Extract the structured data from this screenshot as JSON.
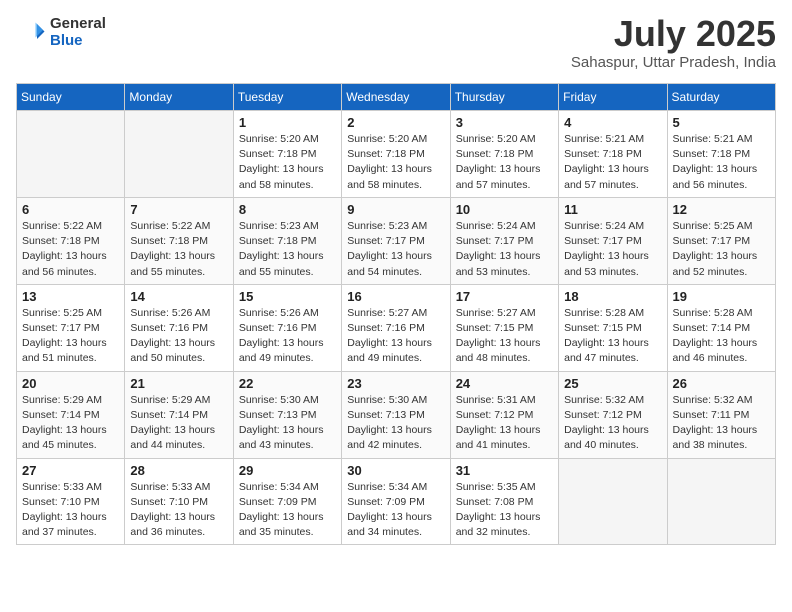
{
  "logo": {
    "general": "General",
    "blue": "Blue"
  },
  "header": {
    "title": "July 2025",
    "location": "Sahaspur, Uttar Pradesh, India"
  },
  "days_of_week": [
    "Sunday",
    "Monday",
    "Tuesday",
    "Wednesday",
    "Thursday",
    "Friday",
    "Saturday"
  ],
  "weeks": [
    [
      {
        "day": "",
        "info": ""
      },
      {
        "day": "",
        "info": ""
      },
      {
        "day": "1",
        "info": "Sunrise: 5:20 AM\nSunset: 7:18 PM\nDaylight: 13 hours\nand 58 minutes."
      },
      {
        "day": "2",
        "info": "Sunrise: 5:20 AM\nSunset: 7:18 PM\nDaylight: 13 hours\nand 58 minutes."
      },
      {
        "day": "3",
        "info": "Sunrise: 5:20 AM\nSunset: 7:18 PM\nDaylight: 13 hours\nand 57 minutes."
      },
      {
        "day": "4",
        "info": "Sunrise: 5:21 AM\nSunset: 7:18 PM\nDaylight: 13 hours\nand 57 minutes."
      },
      {
        "day": "5",
        "info": "Sunrise: 5:21 AM\nSunset: 7:18 PM\nDaylight: 13 hours\nand 56 minutes."
      }
    ],
    [
      {
        "day": "6",
        "info": "Sunrise: 5:22 AM\nSunset: 7:18 PM\nDaylight: 13 hours\nand 56 minutes."
      },
      {
        "day": "7",
        "info": "Sunrise: 5:22 AM\nSunset: 7:18 PM\nDaylight: 13 hours\nand 55 minutes."
      },
      {
        "day": "8",
        "info": "Sunrise: 5:23 AM\nSunset: 7:18 PM\nDaylight: 13 hours\nand 55 minutes."
      },
      {
        "day": "9",
        "info": "Sunrise: 5:23 AM\nSunset: 7:17 PM\nDaylight: 13 hours\nand 54 minutes."
      },
      {
        "day": "10",
        "info": "Sunrise: 5:24 AM\nSunset: 7:17 PM\nDaylight: 13 hours\nand 53 minutes."
      },
      {
        "day": "11",
        "info": "Sunrise: 5:24 AM\nSunset: 7:17 PM\nDaylight: 13 hours\nand 53 minutes."
      },
      {
        "day": "12",
        "info": "Sunrise: 5:25 AM\nSunset: 7:17 PM\nDaylight: 13 hours\nand 52 minutes."
      }
    ],
    [
      {
        "day": "13",
        "info": "Sunrise: 5:25 AM\nSunset: 7:17 PM\nDaylight: 13 hours\nand 51 minutes."
      },
      {
        "day": "14",
        "info": "Sunrise: 5:26 AM\nSunset: 7:16 PM\nDaylight: 13 hours\nand 50 minutes."
      },
      {
        "day": "15",
        "info": "Sunrise: 5:26 AM\nSunset: 7:16 PM\nDaylight: 13 hours\nand 49 minutes."
      },
      {
        "day": "16",
        "info": "Sunrise: 5:27 AM\nSunset: 7:16 PM\nDaylight: 13 hours\nand 49 minutes."
      },
      {
        "day": "17",
        "info": "Sunrise: 5:27 AM\nSunset: 7:15 PM\nDaylight: 13 hours\nand 48 minutes."
      },
      {
        "day": "18",
        "info": "Sunrise: 5:28 AM\nSunset: 7:15 PM\nDaylight: 13 hours\nand 47 minutes."
      },
      {
        "day": "19",
        "info": "Sunrise: 5:28 AM\nSunset: 7:14 PM\nDaylight: 13 hours\nand 46 minutes."
      }
    ],
    [
      {
        "day": "20",
        "info": "Sunrise: 5:29 AM\nSunset: 7:14 PM\nDaylight: 13 hours\nand 45 minutes."
      },
      {
        "day": "21",
        "info": "Sunrise: 5:29 AM\nSunset: 7:14 PM\nDaylight: 13 hours\nand 44 minutes."
      },
      {
        "day": "22",
        "info": "Sunrise: 5:30 AM\nSunset: 7:13 PM\nDaylight: 13 hours\nand 43 minutes."
      },
      {
        "day": "23",
        "info": "Sunrise: 5:30 AM\nSunset: 7:13 PM\nDaylight: 13 hours\nand 42 minutes."
      },
      {
        "day": "24",
        "info": "Sunrise: 5:31 AM\nSunset: 7:12 PM\nDaylight: 13 hours\nand 41 minutes."
      },
      {
        "day": "25",
        "info": "Sunrise: 5:32 AM\nSunset: 7:12 PM\nDaylight: 13 hours\nand 40 minutes."
      },
      {
        "day": "26",
        "info": "Sunrise: 5:32 AM\nSunset: 7:11 PM\nDaylight: 13 hours\nand 38 minutes."
      }
    ],
    [
      {
        "day": "27",
        "info": "Sunrise: 5:33 AM\nSunset: 7:10 PM\nDaylight: 13 hours\nand 37 minutes."
      },
      {
        "day": "28",
        "info": "Sunrise: 5:33 AM\nSunset: 7:10 PM\nDaylight: 13 hours\nand 36 minutes."
      },
      {
        "day": "29",
        "info": "Sunrise: 5:34 AM\nSunset: 7:09 PM\nDaylight: 13 hours\nand 35 minutes."
      },
      {
        "day": "30",
        "info": "Sunrise: 5:34 AM\nSunset: 7:09 PM\nDaylight: 13 hours\nand 34 minutes."
      },
      {
        "day": "31",
        "info": "Sunrise: 5:35 AM\nSunset: 7:08 PM\nDaylight: 13 hours\nand 32 minutes."
      },
      {
        "day": "",
        "info": ""
      },
      {
        "day": "",
        "info": ""
      }
    ]
  ]
}
